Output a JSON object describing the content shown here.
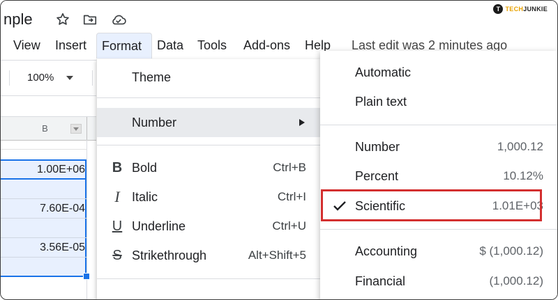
{
  "doc": {
    "title_fragment": "nple"
  },
  "icons": {
    "star": "star-icon",
    "move": "move-to-folder-icon",
    "cloud": "cloud-status-icon"
  },
  "brand": {
    "logo_letter": "T",
    "name_part1": "TECH",
    "name_part2": "JUNKIE"
  },
  "menu": {
    "items": [
      "View",
      "Insert",
      "Format",
      "Data",
      "Tools",
      "Add-ons",
      "Help"
    ],
    "active": "Format",
    "last_edit": "Last edit was 2 minutes ago"
  },
  "toolbar": {
    "zoom": "100%"
  },
  "sheet": {
    "column_header": "B",
    "cells": [
      "1.00E+06",
      "7.60E-04",
      "3.56E-05"
    ]
  },
  "format_menu": {
    "theme": "Theme",
    "number": "Number",
    "bold": {
      "label": "Bold",
      "shortcut": "Ctrl+B",
      "icon": "B"
    },
    "italic": {
      "label": "Italic",
      "shortcut": "Ctrl+I",
      "icon": "I"
    },
    "underline": {
      "label": "Underline",
      "shortcut": "Ctrl+U",
      "icon": "U"
    },
    "strikethrough": {
      "label": "Strikethrough",
      "shortcut": "Alt+Shift+5",
      "icon": "S"
    }
  },
  "number_menu": {
    "automatic": "Automatic",
    "plain_text": "Plain text",
    "number": {
      "label": "Number",
      "example": "1,000.12"
    },
    "percent": {
      "label": "Percent",
      "example": "10.12%"
    },
    "scientific": {
      "label": "Scientific",
      "example": "1.01E+03",
      "checked": true
    },
    "accounting": {
      "label": "Accounting",
      "example": "$ (1,000.12)"
    },
    "financial": {
      "label": "Financial",
      "example": "(1,000.12)"
    }
  },
  "colors": {
    "accent": "#1a73e8",
    "highlight_box": "#d32f2f",
    "selection_fill": "#e8f0fe"
  }
}
